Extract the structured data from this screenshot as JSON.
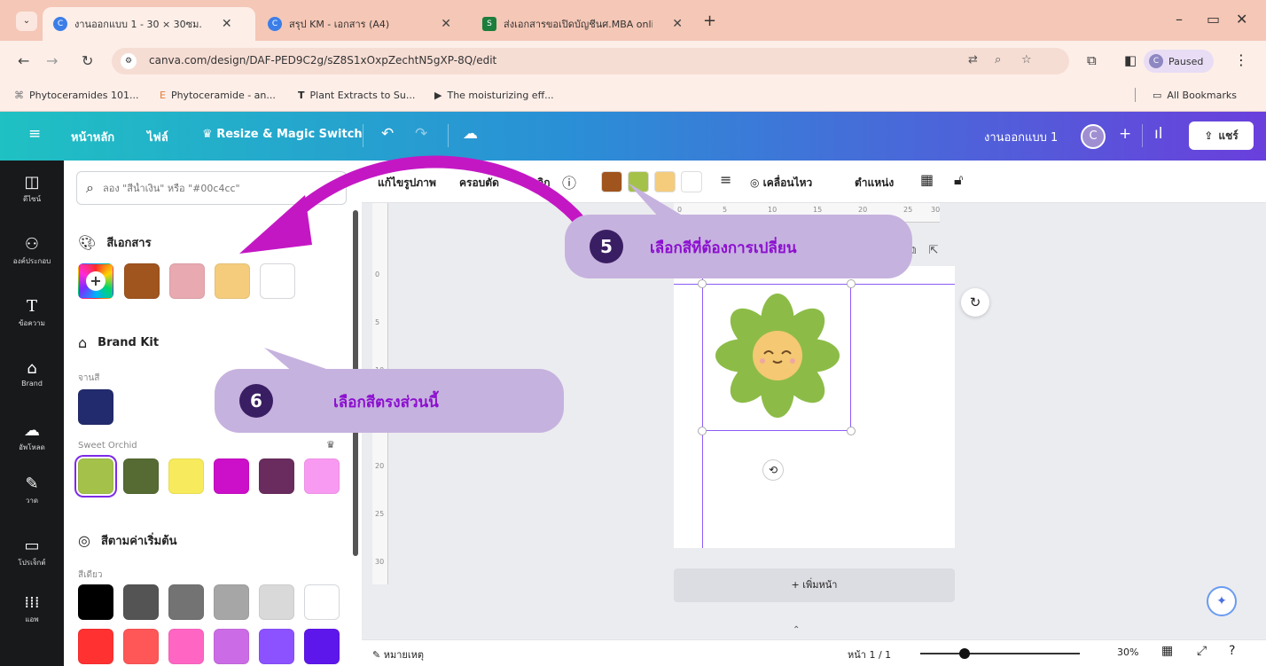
{
  "browser": {
    "tabs": [
      {
        "label": "งานออกแบบ 1 - 30 × 30ซม.",
        "active": true
      },
      {
        "label": "สรุป KM - เอกสาร (A4)",
        "active": false
      },
      {
        "label": "ส่งเอกสารขอเปิดบัญชีนศ.MBA online",
        "active": false
      }
    ],
    "url": "canva.com/design/DAF-PED9C2g/sZ8S1xOxpZechtN5gXP-8Q/edit",
    "profile_label": "Paused",
    "profile_initial": "C",
    "bookmarks": [
      {
        "label": "Phytoceramides 101...",
        "icon": "bookmark-icon"
      },
      {
        "label": "Phytoceramide - an...",
        "icon": "bookmark-icon"
      },
      {
        "label": "Plant Extracts to Su...",
        "icon": "bookmark-icon"
      },
      {
        "label": "The moisturizing eff...",
        "icon": "bookmark-icon"
      }
    ],
    "all_bookmarks": "All Bookmarks"
  },
  "header": {
    "home": "หน้าหลัก",
    "file": "ไฟล์",
    "resize": "Resize & Magic Switch",
    "design_name": "งานออกแบบ 1",
    "avatar_initial": "C",
    "share": "แชร์",
    "colors": {
      "gradient_start": "#1fc1c3",
      "gradient_end": "#6a3fdc"
    }
  },
  "rail": [
    {
      "label": "ดีไซน์",
      "icon": "layout-icon"
    },
    {
      "label": "องค์ประกอบ",
      "icon": "elements-icon"
    },
    {
      "label": "ข้อความ",
      "icon": "text-icon"
    },
    {
      "label": "Brand",
      "icon": "brand-icon"
    },
    {
      "label": "อัพโหลด",
      "icon": "upload-icon"
    },
    {
      "label": "วาด",
      "icon": "draw-icon"
    },
    {
      "label": "โปรเจ็กต์",
      "icon": "folder-icon"
    },
    {
      "label": "แอพ",
      "icon": "apps-icon"
    }
  ],
  "panel": {
    "search_placeholder": "ลอง \"สีน้ำเงิน\" หรือ \"#00c4cc\"",
    "document_colors": {
      "title": "สีเอกสาร",
      "swatches": [
        "#a0541e",
        "#e8a9b0",
        "#f4cc7c",
        "#ffffff"
      ]
    },
    "brand_kit": {
      "title": "Brand Kit",
      "palette_label": "จานสี",
      "palette": [
        "#222b6e"
      ],
      "sweet_orchid_label": "Sweet Orchid",
      "sweet_orchid": [
        "#a4c24a",
        "#566b34",
        "#f7ea5c",
        "#cc0fc8",
        "#6a2c5e",
        "#f99af2"
      ]
    },
    "default_colors": {
      "title": "สีตามค่าเริ่มต้น",
      "solid_label": "สีเดียว",
      "row1": [
        "#000000",
        "#545454",
        "#737373",
        "#a6a6a6",
        "#d9d9d9",
        "#ffffff"
      ],
      "row2": [
        "#ff3131",
        "#ff5757",
        "#ff66c4",
        "#cb6ce6",
        "#8c52ff",
        "#5e17eb"
      ]
    }
  },
  "toolbar": {
    "edit_image": "แก้ไขรูปภาพ",
    "crop": "ครอบตัด",
    "flip": "พลิก",
    "colors": [
      "#a0541e",
      "#a4c24a",
      "#f4cc7c",
      "#ffffff"
    ],
    "animate": "เคลื่อนไหว",
    "position": "ตำแหน่ง"
  },
  "ruler": {
    "top": [
      "0",
      "5",
      "10",
      "15",
      "20",
      "25",
      "30"
    ],
    "left": [
      "0",
      "5",
      "10",
      "15",
      "20",
      "25",
      "30"
    ]
  },
  "canvas": {
    "add_page": "+ เพิ่มหน้า",
    "flower": {
      "petal": "#8cbc47",
      "center": "#f5c873",
      "cheek": "#f0a6a0"
    }
  },
  "bottom": {
    "notes": "หมายเหตุ",
    "page_indicator": "หน้า 1 / 1",
    "zoom": "30%",
    "zoom_fraction": 0.28
  },
  "callouts": [
    {
      "number": "5",
      "text": "เลือกสีที่ต้องการเปลี่ยน"
    },
    {
      "number": "6",
      "text": "เลือกสีตรงส่วนนี้"
    }
  ],
  "accent": {
    "arrow": "#c417c4",
    "callout_bg": "#c6b2de",
    "callout_text": "#8c0fd0",
    "callout_num": "#3a1e63"
  }
}
